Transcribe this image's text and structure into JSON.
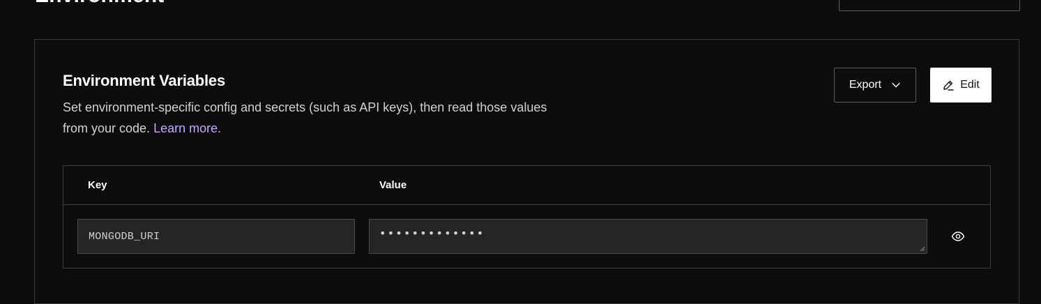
{
  "page": {
    "heading": "Environment"
  },
  "env_panel": {
    "title": "Environment Variables",
    "description": "Set environment-specific config and secrets (such as API keys), then read those values from your code.",
    "learn_more": "Learn more",
    "period": ".",
    "export_label": "Export",
    "edit_label": "Edit"
  },
  "table": {
    "headers": [
      "Key",
      "Value"
    ],
    "rows": [
      {
        "key": "MONGODB_URI",
        "value_masked": "•••••••••••••"
      }
    ]
  },
  "icons": {
    "export_chevron": "chevron-down-icon",
    "edit": "pencil-icon",
    "reveal": "eye-icon"
  },
  "colors": {
    "background": "#0d0d0d",
    "link": "#c2a7ff",
    "input_bg": "#252525",
    "border": "#3f3f3f"
  }
}
